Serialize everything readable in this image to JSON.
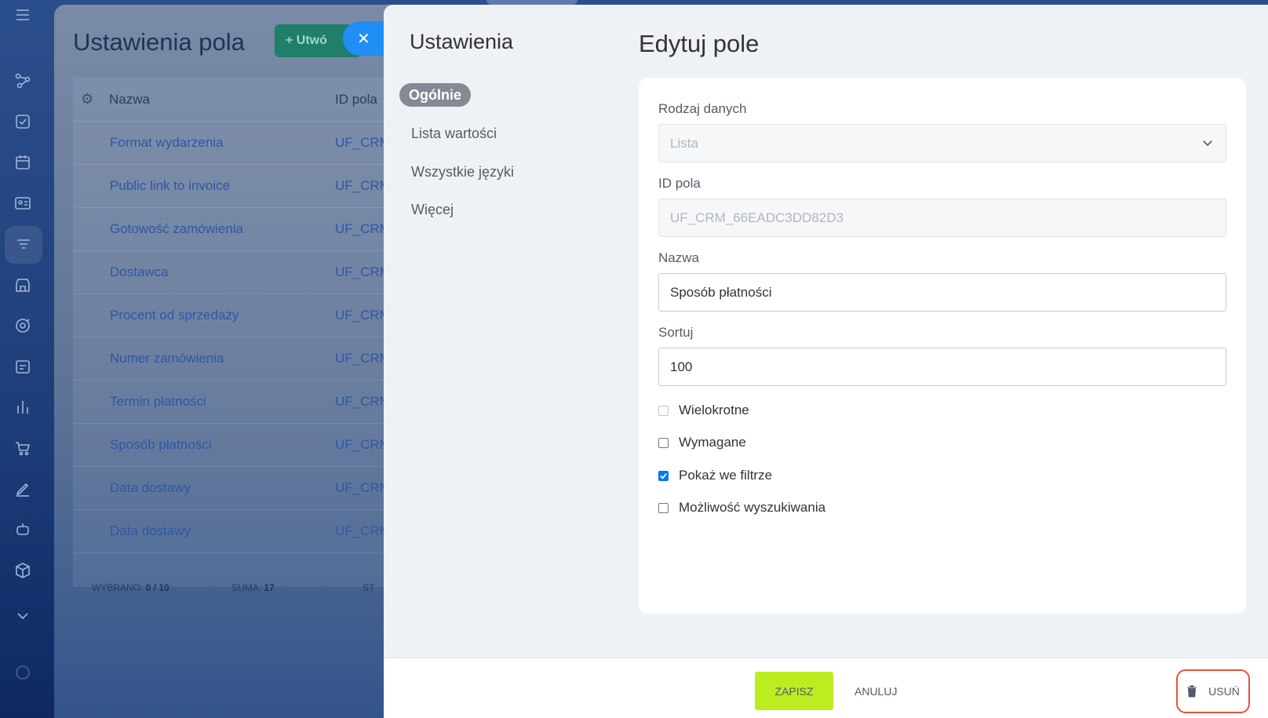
{
  "background_page": {
    "title": "Ustawienia pola",
    "create_button": "+ Utwó",
    "columns": {
      "name": "Nazwa",
      "id": "ID pola"
    },
    "rows": [
      {
        "name": "Format wydarzenia",
        "id": "UF_CRM_"
      },
      {
        "name": "Public link to invoice",
        "id": "UF_CRM_"
      },
      {
        "name": "Gotowość zamówienia",
        "id": "UF_CRM_"
      },
      {
        "name": "Dostawca",
        "id": "UF_CRM_"
      },
      {
        "name": "Procent od sprzedaży",
        "id": "UF_CRM_"
      },
      {
        "name": "Numer zamówienia",
        "id": "UF_CRM_"
      },
      {
        "name": "Termin płatności",
        "id": "UF_CRM_"
      },
      {
        "name": "Sposób płatności",
        "id": "UF_CRM_"
      },
      {
        "name": "Data dostawy",
        "id": "UF_CRM_"
      },
      {
        "name": "Data dostawy",
        "id": "UF_CRM_"
      }
    ],
    "footer": {
      "selected_label": "WYBRANO:",
      "selected_value": "0 / 10",
      "sum_label": "SUMA:",
      "sum_value": "17",
      "st_label": "ST"
    }
  },
  "panel": {
    "settings_title": "Ustawienia",
    "nav": [
      "Ogólnie",
      "Lista wartości",
      "Wszystkie języki",
      "Więcej"
    ],
    "edit_title": "Edytuj pole",
    "fields": {
      "data_type_label": "Rodzaj danych",
      "data_type_value": "Lista",
      "field_id_label": "ID pola",
      "field_id_value": "UF_CRM_66EADC3DD82D3",
      "name_label": "Nazwa",
      "name_value": "Sposób płatności",
      "sort_label": "Sortuj",
      "sort_value": "100"
    },
    "checkboxes": [
      {
        "label": "Wielokrotne",
        "checked": false,
        "disabled": true
      },
      {
        "label": "Wymagane",
        "checked": false,
        "disabled": false
      },
      {
        "label": "Pokaż we filtrze",
        "checked": true,
        "disabled": false
      },
      {
        "label": "Możliwość wyszukiwania",
        "checked": false,
        "disabled": false
      }
    ]
  },
  "buttons": {
    "save": "ZAPISZ",
    "cancel": "ANULUJ",
    "delete": "USUŃ"
  },
  "colors": {
    "accent_save": "#bbed21",
    "close_button": "#1f8ff5",
    "delete_highlight": "#e0563a",
    "checkbox_checked": "#0075ff"
  }
}
